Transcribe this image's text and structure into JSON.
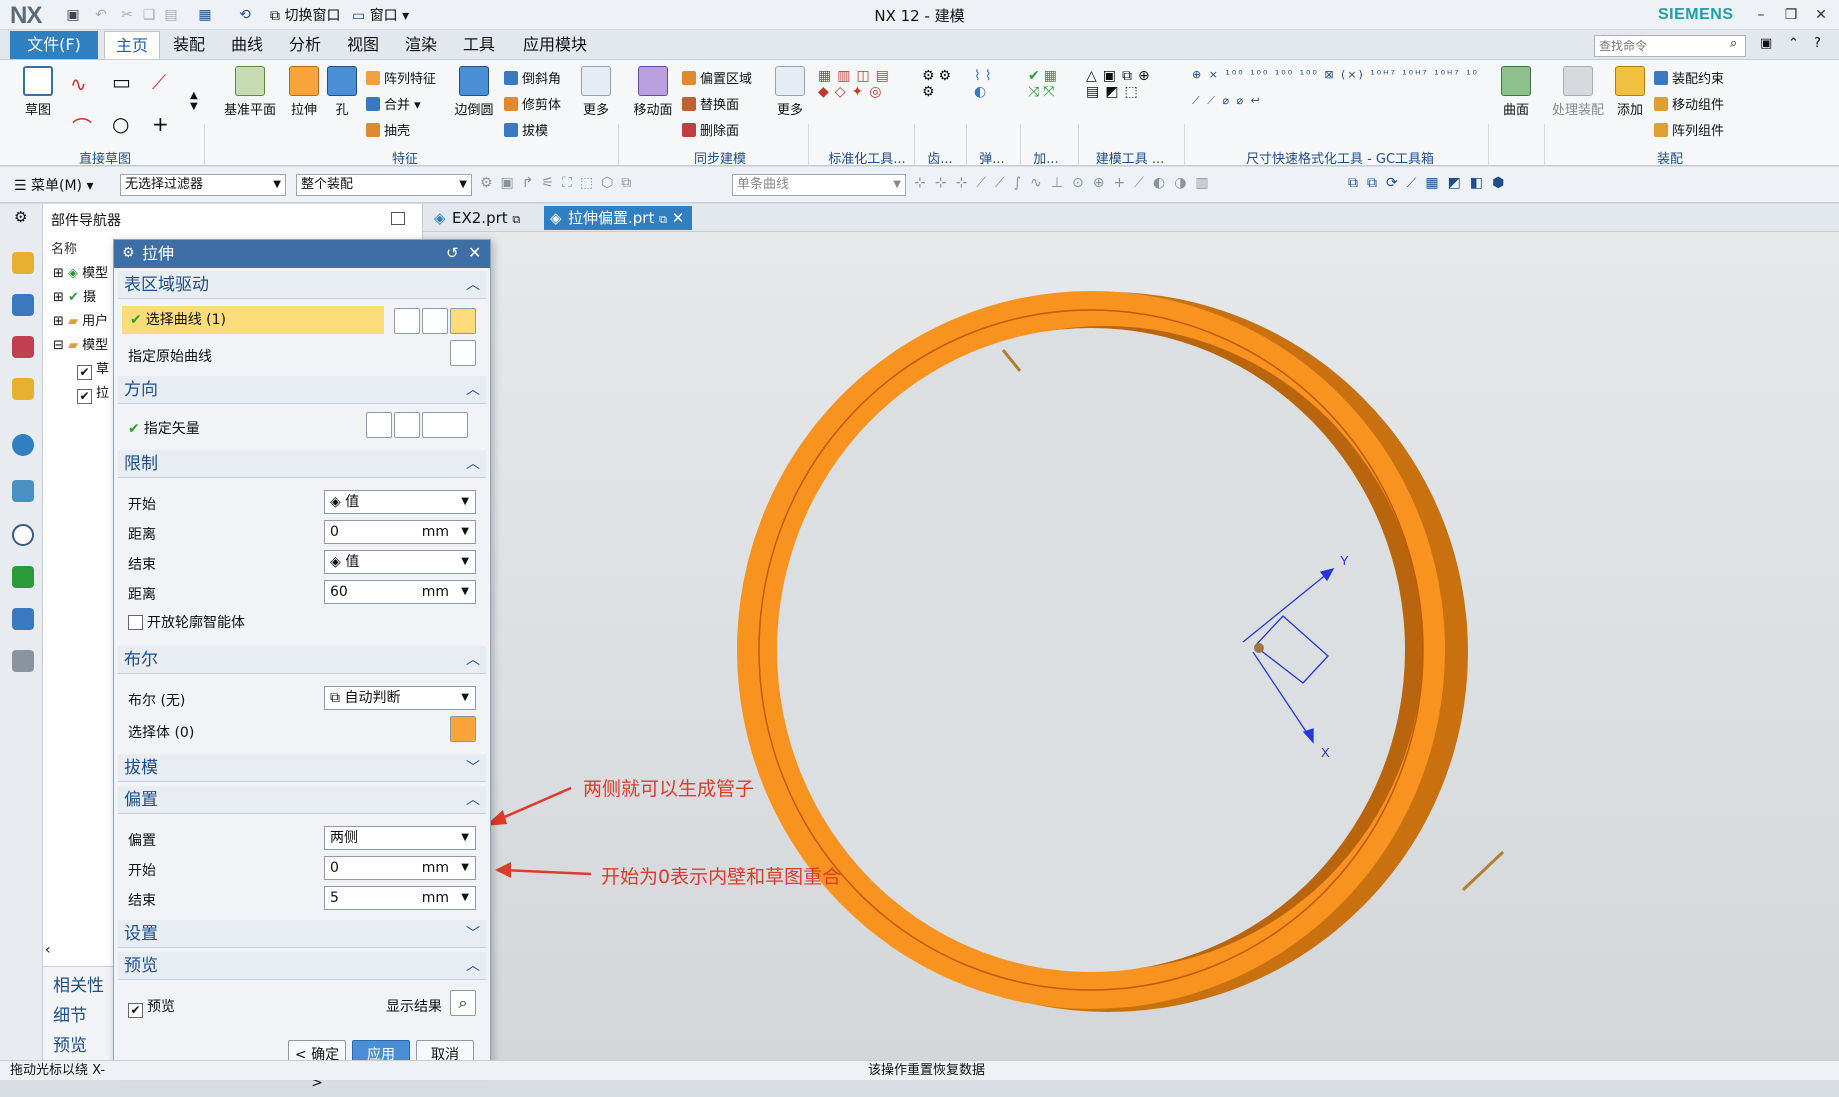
{
  "titlebar": {
    "logo": "NX",
    "switch_window": "切换窗口",
    "window_menu": "窗口",
    "title": "NX 12 - 建模",
    "brand": "SIEMENS",
    "minimize": "–",
    "restore": "❐",
    "close": "✕"
  },
  "menubar": {
    "file": "文件(F)",
    "tabs": [
      "主页",
      "装配",
      "曲线",
      "分析",
      "视图",
      "渲染",
      "工具",
      "应用模块"
    ],
    "search_placeholder": "查找命令"
  },
  "ribbon": {
    "sketch_btn": "草图",
    "group_sketch": "直接草图",
    "datum_plane": "基准平面",
    "extrude": "拉伸",
    "hole": "孔",
    "pattern_feature": "阵列特征",
    "unite": "合并",
    "shell": "抽壳",
    "edge_blend": "边倒圆",
    "chamfer": "倒斜角",
    "trim_body": "修剪体",
    "draft": "拔模",
    "more1": "更多",
    "group_feature": "特征",
    "move_face": "移动面",
    "offset_region": "偏置区域",
    "replace_face": "替换面",
    "delete_face": "删除面",
    "more2": "更多",
    "group_sync": "同步建模",
    "group_std": "标准化工具...",
    "group_gear": "齿...",
    "group_spring": "弹...",
    "group_add": "加...",
    "group_model": "建模工具 ...",
    "group_dim": "尺寸快速格式化工具 - GC工具箱",
    "surface": "曲面",
    "process_assembly": "处理装配",
    "add": "添加",
    "assembly_constraint": "装配约束",
    "move_component": "移动组件",
    "pattern_component": "阵列组件",
    "group_assembly": "装配"
  },
  "toolbar2": {
    "menu": "菜单(M)",
    "filter": "无选择过滤器",
    "scope": "整个装配",
    "curve_rule": "单条曲线"
  },
  "navigator": {
    "title": "部件导航器",
    "col_name": "名称",
    "rows": [
      "模型",
      "摄",
      "用户",
      "模型",
      "草",
      "拉"
    ],
    "related": "相关性",
    "details": "细节",
    "preview": "预览"
  },
  "dialog": {
    "title": "拉伸",
    "sec_section": "表区域驱动",
    "select_curve": "选择曲线 (1)",
    "specify_origin_curve": "指定原始曲线",
    "sec_direction": "方向",
    "specify_vector": "指定矢量",
    "sec_limits": "限制",
    "start": "开始",
    "start_value": "值",
    "distance": "距离",
    "start_distance": "0",
    "end": "结束",
    "end_value": "值",
    "end_distance": "60",
    "unit": "mm",
    "open_profile": "开放轮廓智能体",
    "sec_boolean": "布尔",
    "boolean_none": "布尔 (无)",
    "boolean_value": "自动判断",
    "select_body": "选择体 (0)",
    "sec_draft": "拔模",
    "sec_offset": "偏置",
    "offset": "偏置",
    "offset_value": "两侧",
    "offset_start": "开始",
    "offset_start_value": "0",
    "offset_end": "结束",
    "offset_end_value": "5",
    "sec_settings": "设置",
    "sec_preview": "预览",
    "preview": "预览",
    "show_result": "显示结果",
    "ok": "< 确定 >",
    "apply": "应用",
    "cancel": "取消"
  },
  "file_tabs": [
    "EX2.prt",
    "拉伸偏置.prt"
  ],
  "annotations": {
    "arrow1": "两侧就可以生成管子",
    "arrow2": "开始为0表示内壁和草图重合"
  },
  "viewport": {
    "axis_y": "Y",
    "axis_x": "X"
  },
  "status": {
    "left": "拖动光标以绕 X-",
    "center": "该操作重置恢复数据"
  },
  "colors": {
    "ring": "#f7931e",
    "accent": "#2f7fc1",
    "annotation": "#e03a2b"
  }
}
